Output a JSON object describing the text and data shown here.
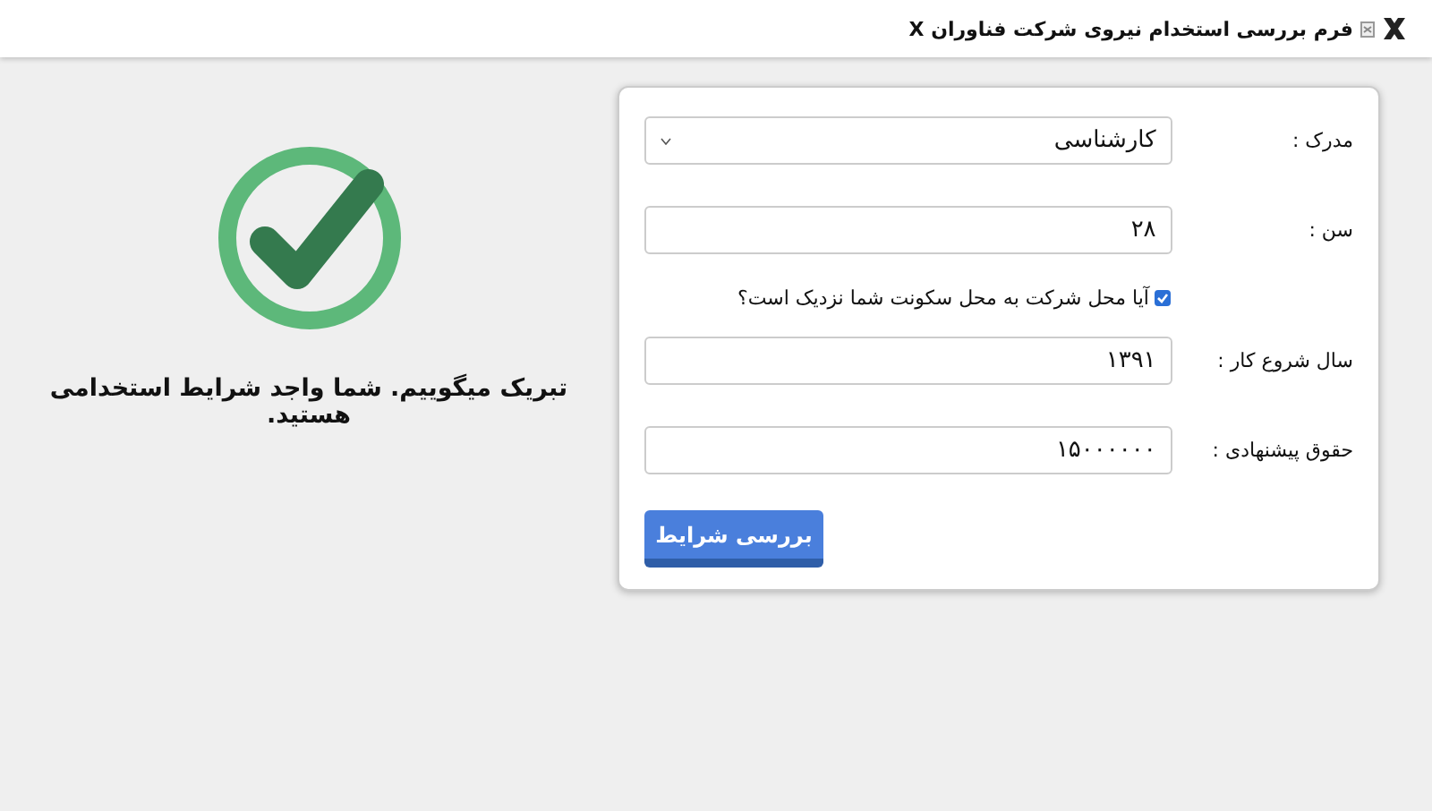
{
  "header": {
    "title": "فرم بررسی استخدام نیروی شرکت فناوران X"
  },
  "form": {
    "fields": [
      {
        "kind": "select",
        "label": "مدرک :",
        "value": "کارشناسی"
      },
      {
        "kind": "text",
        "label": "سن :",
        "value": "۲۸"
      },
      {
        "kind": "checkbox",
        "label": "آیا محل شرکت به محل سکونت شما نزدیک است؟",
        "checked": true
      },
      {
        "kind": "text",
        "label": "سال شروع کار :",
        "value": "۱۳۹۱"
      },
      {
        "kind": "text",
        "label": "حقوق پیشنهادی :",
        "value": "۱۵۰۰۰۰۰۰"
      }
    ],
    "submit": "بررسی شرایط"
  },
  "result": {
    "success": true,
    "message": "تبریک میگوییم. شما واجد شرایط استخدامی هستید."
  }
}
